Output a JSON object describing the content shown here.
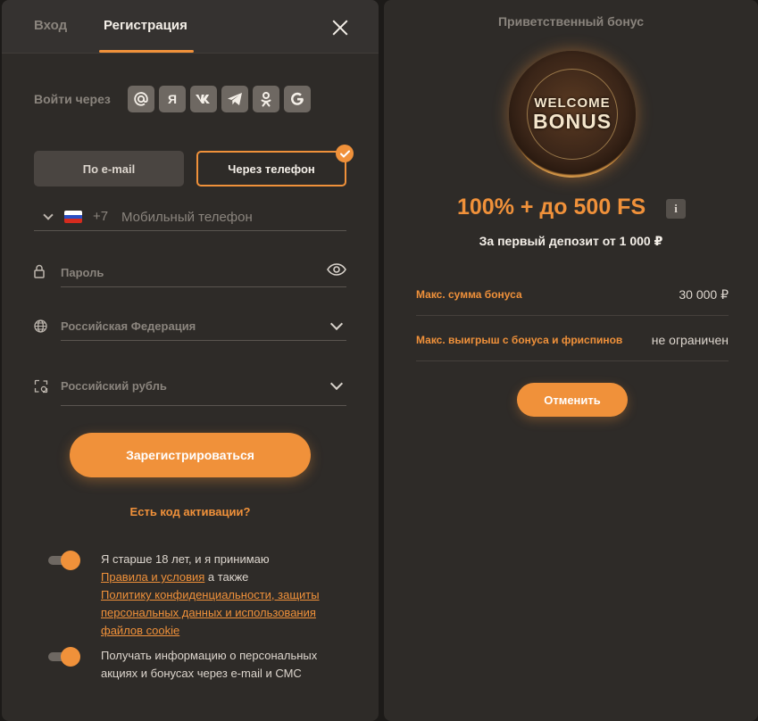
{
  "tabs": {
    "login": "Вход",
    "register": "Регистрация"
  },
  "social": {
    "label": "Войти через",
    "buttons": [
      {
        "name": "mail-ru-icon",
        "glyph": "@"
      },
      {
        "name": "yandex-icon",
        "glyph": "Я"
      },
      {
        "name": "vk-icon",
        "glyph": "vk"
      },
      {
        "name": "telegram-icon",
        "glyph": "tg"
      },
      {
        "name": "odnoklassniki-icon",
        "glyph": "ok"
      },
      {
        "name": "google-icon",
        "glyph": "G"
      }
    ]
  },
  "method": {
    "email_label": "По e-mail",
    "phone_label": "Через телефон",
    "selected": "phone"
  },
  "phone": {
    "prefix": "+7",
    "placeholder": "Мобильный телефон",
    "country_flag": "russia-flag-icon"
  },
  "password": {
    "placeholder": "Пароль"
  },
  "country": {
    "value": "Российская Федерация"
  },
  "currency": {
    "value": "Российский рубль"
  },
  "register_button": "Зарегистрироваться",
  "activation_link": "Есть код активации?",
  "consent": {
    "age_text_1": "Я старше 18 лет, и я принимаю",
    "terms_link": "Правила и условия",
    "age_text_2": " а также",
    "privacy_link": "Политику конфиденциальности, защиты персональных данных и использования файлов cookie",
    "age_on": true,
    "marketing_text": "Получать информацию о персональных акциях и бонусах через e-mail и СМС",
    "marketing_on": true
  },
  "bonus": {
    "title": "Приветственный бонус",
    "coin_line1": "WELCOME",
    "coin_line2": "BONUS",
    "amount": "100% + до 500 FS",
    "info_glyph": "i",
    "subtitle": "За первый депозит от 1 000 ₽",
    "rows": [
      {
        "key": "Макс. сумма бонуса",
        "value": "30 000 ₽"
      },
      {
        "key": "Макс. выигрыш с бонуса и фриспинов",
        "value": "не ограничен"
      }
    ],
    "cancel_button": "Отменить"
  },
  "colors": {
    "accent": "#f0913a",
    "panel": "#2e2b28",
    "background": "#1c1a18"
  }
}
